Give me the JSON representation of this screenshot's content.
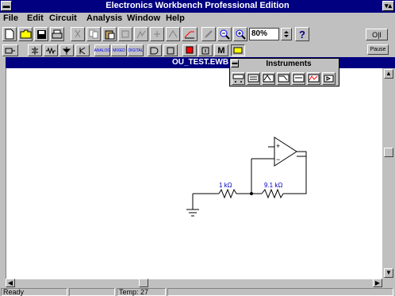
{
  "window": {
    "title": "Electronics Workbench Professional Edition"
  },
  "menu": {
    "items": [
      "File",
      "Edit",
      "Circuit",
      "Analysis",
      "Window",
      "Help"
    ]
  },
  "toolbar": {
    "zoom_value": "80%",
    "help_label": "?",
    "pause_label": "Pause",
    "power_label": "O|I",
    "analog_ic_label": "ANALOG",
    "mixed_ic_label": "MIXED",
    "digital_ic_label": "DIGITAL",
    "misc_label": "M"
  },
  "document": {
    "title": "OU_TEST.EWB"
  },
  "instruments": {
    "title": "Instruments"
  },
  "circuit": {
    "r1_label": "1 kΩ",
    "r2_label": "9.1 kΩ",
    "opamp_plus": "+",
    "opamp_minus": "−"
  },
  "statusbar": {
    "status": "Ready",
    "temp": "Temp: 27"
  }
}
